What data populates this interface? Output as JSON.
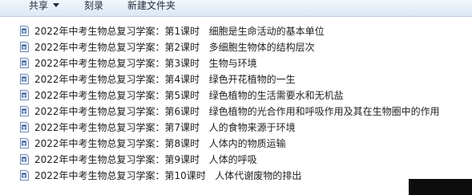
{
  "toolbar": {
    "share_label": "共享",
    "burn_label": "刻录",
    "new_folder_label": "新建文件夹"
  },
  "files": [
    {
      "name": "2022年中考生物总复习学案：第1课时   细胞是生命活动的基本单位",
      "icon": "word-doc-icon"
    },
    {
      "name": "2022年中考生物总复习学案：第2课时   多细胞生物体的结构层次",
      "icon": "word-doc-icon"
    },
    {
      "name": "2022年中考生物总复习学案：第3课时   生物与环境",
      "icon": "word-doc-icon"
    },
    {
      "name": "2022年中考生物总复习学案：第4课时   绿色开花植物的一生",
      "icon": "word-doc-icon"
    },
    {
      "name": "2022年中考生物总复习学案：第5课时   绿色植物的生活需要水和无机盐",
      "icon": "word-doc-icon"
    },
    {
      "name": "2022年中考生物总复习学案：第6课时   绿色植物的光合作用和呼吸作用及其在生物圈中的作用",
      "icon": "word-doc-icon"
    },
    {
      "name": "2022年中考生物总复习学案：第7课时   人的食物来源于环境",
      "icon": "word-doc-icon"
    },
    {
      "name": "2022年中考生物总复习学案：第8课时   人体内的物质运输",
      "icon": "word-doc-icon"
    },
    {
      "name": "2022年中考生物总复习学案：第9课时   人体的呼吸",
      "icon": "word-doc-icon"
    },
    {
      "name": "2022年中考生物总复习学案：第10课时   人体代谢废物的排出",
      "icon": "word-doc-icon"
    }
  ],
  "colors": {
    "icon_blue": "#2b5797",
    "toolbar_top": "#f3f7fc",
    "toolbar_bottom": "#dde7f3"
  }
}
